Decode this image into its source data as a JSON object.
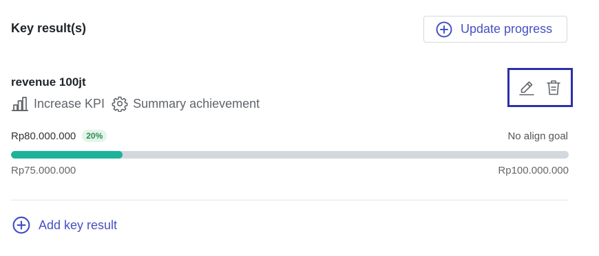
{
  "section": {
    "title": "Key result(s)"
  },
  "header": {
    "update_label": "Update progress"
  },
  "key_result": {
    "title": "revenue 100jt",
    "type_label": "Increase KPI",
    "summary_label": "Summary achievement",
    "current_value": "Rp80.000.000",
    "percent_label": "20%",
    "progress_fraction": 0.2,
    "align_label": "No align goal",
    "start_value": "Rp75.000.000",
    "target_value": "Rp100.000.000"
  },
  "footer": {
    "add_label": "Add key result"
  },
  "icons": {
    "update": "plus-circle-icon",
    "type": "bar-chart-icon",
    "summary": "gear-icon",
    "edit": "pencil-icon",
    "delete": "trash-icon",
    "add": "plus-circle-icon"
  },
  "colors": {
    "accent": "#4450c4",
    "progress_fill": "#1db39b",
    "progress_track": "#d3d8de",
    "badge_bg": "#e3f4e8",
    "badge_text": "#2e8b57",
    "highlight_border": "#2b2fa8"
  }
}
